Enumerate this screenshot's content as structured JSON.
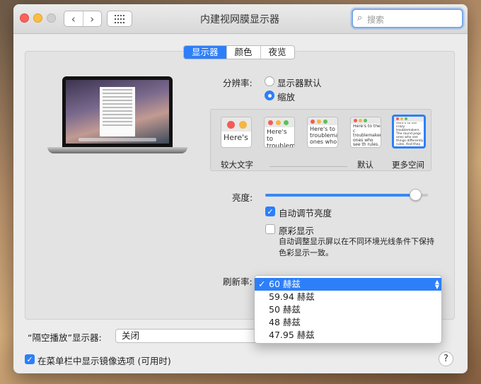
{
  "window": {
    "title": "内建视网膜显示器"
  },
  "search": {
    "placeholder": "搜索"
  },
  "tabs": [
    {
      "label": "显示器",
      "selected": true
    },
    {
      "label": "颜色",
      "selected": false
    },
    {
      "label": "夜览",
      "selected": false
    }
  ],
  "resolution": {
    "label": "分辨率:",
    "options": [
      {
        "label": "显示器默认",
        "selected": false
      },
      {
        "label": "缩放",
        "selected": true
      }
    ],
    "scales": [
      {
        "label": "较大文字",
        "sample": "Here's"
      },
      {
        "label": "",
        "sample": "Here's to troublem"
      },
      {
        "label": "",
        "sample": "Here's to troublema ones who"
      },
      {
        "label": "默认",
        "sample": "Here's to the c troublemakers. ones who see th rules. And they"
      },
      {
        "label": "更多空间",
        "sample": "Here's to the crazy troublemakers. The round pegs ones who see things differently rules. And they have no respect can quote them, disagree with"
      }
    ]
  },
  "brightness": {
    "label": "亮度:",
    "value": 0.95,
    "auto_label": "自动调节亮度",
    "auto_checked": true
  },
  "true_tone": {
    "label": "原彩显示",
    "checked": false,
    "description": "自动调整显示屏以在不同环境光线条件下保持色彩显示一致。"
  },
  "refresh_rate": {
    "label": "刷新率:",
    "options": [
      "60 赫兹",
      "59.94 赫兹",
      "50 赫兹",
      "48 赫兹",
      "47.95 赫兹"
    ],
    "selected": "60 赫兹",
    "check_mark": "✓"
  },
  "airplay": {
    "label": "“隔空播放”显示器:",
    "value": "关闭"
  },
  "mirror_menu": {
    "label": "在菜单栏中显示镜像选项 (可用时)",
    "checked": true
  },
  "help": {
    "label": "?"
  },
  "colors": {
    "accent": "#2d7ff9"
  }
}
